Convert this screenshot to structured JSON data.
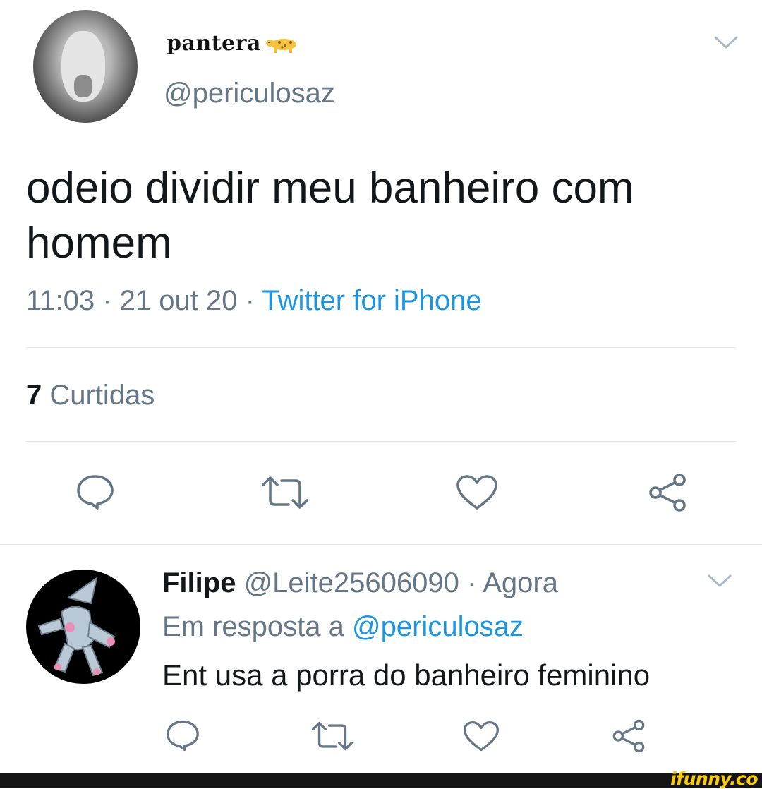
{
  "tweet": {
    "display_name": "pantera",
    "name_emoji": "leopard-icon",
    "handle": "@periculosaz",
    "text": "odeio dividir meu banheiro com homem",
    "time": "11:03 · 21 out 20 · ",
    "source": "Twitter for iPhone",
    "likes_count": "7",
    "likes_label": " Curtidas"
  },
  "reply": {
    "name": "Filipe",
    "meta": " @Leite25606090 · Agora",
    "reply_prefix": "Em resposta a ",
    "reply_mention": "@periculosaz",
    "text": "Ent usa a porra do banheiro feminino"
  },
  "watermark": "ifunny.co",
  "colors": {
    "text": "#14171a",
    "secondary": "#657786",
    "link": "#1b95e0",
    "divider": "#e1e8ed",
    "watermark": "#ffcc00"
  },
  "icons": [
    "comment-icon",
    "retweet-icon",
    "like-icon",
    "share-icon",
    "chevron-down-icon"
  ]
}
